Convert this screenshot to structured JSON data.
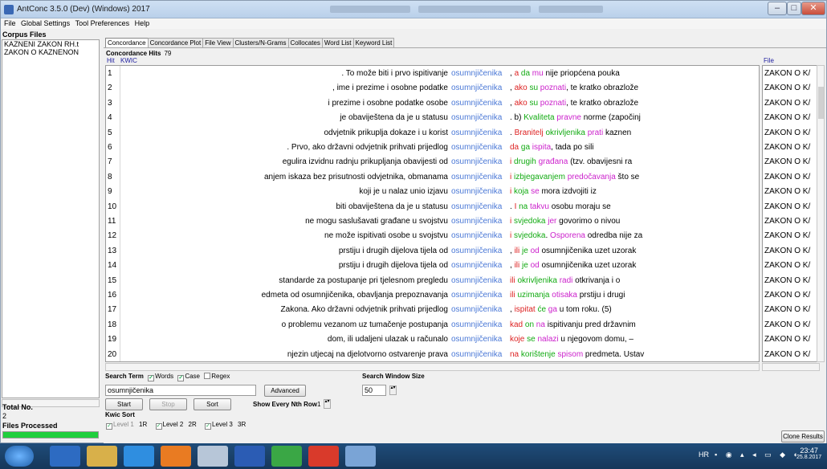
{
  "window": {
    "title": "AntConc 3.5.0 (Dev) (Windows) 2017"
  },
  "menu": [
    "File",
    "Global Settings",
    "Tool Preferences",
    "Help"
  ],
  "left": {
    "corpus_title": "Corpus Files",
    "files": [
      "KAZNENI ZAKON RH.t",
      "ZAKON O KAZNENON"
    ],
    "total_label": "Total No.",
    "total_value": "2",
    "processed_label": "Files Processed",
    "progress": 1.0
  },
  "tabs": [
    "Concordance",
    "Concordance Plot",
    "File View",
    "Clusters/N-Grams",
    "Collocates",
    "Word List",
    "Keyword List"
  ],
  "concordance": {
    "hits_label": "Concordance Hits",
    "hits_value": "79",
    "col_hit": "Hit",
    "col_kwic": "KWIC",
    "col_file": "File",
    "rows": [
      {
        "n": "1",
        "left": ". To može biti i prvo ispitivanje",
        "kw": "osumnjičenika",
        "right": [
          [
            ", ",
            "#000"
          ],
          [
            "a",
            "#d22"
          ],
          [
            " da",
            "#1a1"
          ],
          [
            " mu",
            "#c2c"
          ],
          [
            " nije priopćena pouka",
            "#000"
          ]
        ],
        "file": "ZAKON O K/"
      },
      {
        "n": "2",
        "left": ", ime i prezime i osobne podatke",
        "kw": "osumnjičenika",
        "right": [
          [
            ", ",
            "#000"
          ],
          [
            "ako",
            "#d22"
          ],
          [
            " su",
            "#1a1"
          ],
          [
            " poznati",
            "#c2c"
          ],
          [
            ", te kratko obrazlože",
            "#000"
          ]
        ],
        "file": "ZAKON O K/"
      },
      {
        "n": "3",
        "left": "i prezime i osobne podatke osobe",
        "kw": "osumnjičenika",
        "right": [
          [
            ", ",
            "#000"
          ],
          [
            "ako",
            "#d22"
          ],
          [
            " su",
            "#1a1"
          ],
          [
            " poznati",
            "#c2c"
          ],
          [
            ", te kratko obrazlože",
            "#000"
          ]
        ],
        "file": "ZAKON O K/"
      },
      {
        "n": "4",
        "left": "je obaviještena da je u statusu",
        "kw": "osumnjičenika",
        "right": [
          [
            ". b) ",
            "#000"
          ],
          [
            "Kvaliteta",
            "#1a1"
          ],
          [
            " pravne",
            "#c2c"
          ],
          [
            " norme (započinj",
            "#000"
          ]
        ],
        "file": "ZAKON O K/"
      },
      {
        "n": "5",
        "left": "odvjetnik prikuplja dokaze i u korist",
        "kw": "osumnjičenika",
        "right": [
          [
            ". ",
            "#000"
          ],
          [
            "Branitelj",
            "#d22"
          ],
          [
            " okrivljenika",
            "#1a1"
          ],
          [
            " prati",
            "#c2c"
          ],
          [
            " kaznen",
            "#000"
          ]
        ],
        "file": "ZAKON O K/"
      },
      {
        "n": "6",
        "left": ". Prvo, ako državni odvjetnik prihvati prijedlog",
        "kw": "osumnjičenika",
        "right": [
          [
            " ",
            "#000"
          ],
          [
            "da",
            "#d22"
          ],
          [
            " ga",
            "#1a1"
          ],
          [
            " ispita",
            "#c2c"
          ],
          [
            ", tada po sili",
            "#000"
          ]
        ],
        "file": "ZAKON O K/"
      },
      {
        "n": "7",
        "left": "egulira izvidnu radnju prikupljanja obavijesti od",
        "kw": "osumnjičenika",
        "right": [
          [
            " ",
            "#000"
          ],
          [
            "i",
            "#d22"
          ],
          [
            " drugih",
            "#1a1"
          ],
          [
            " građana",
            "#c2c"
          ],
          [
            " (tzv. obavijesni ra",
            "#000"
          ]
        ],
        "file": "ZAKON O K/"
      },
      {
        "n": "8",
        "left": "anjem iskaza bez prisutnosti odvjetnika, obmanama",
        "kw": "osumnjičenika",
        "right": [
          [
            " ",
            "#000"
          ],
          [
            "i",
            "#d22"
          ],
          [
            " izbjegavanjem",
            "#1a1"
          ],
          [
            " predočavanja",
            "#c2c"
          ],
          [
            " što se",
            "#000"
          ]
        ],
        "file": "ZAKON O K/"
      },
      {
        "n": "9",
        "left": "koji je u nalaz unio izjavu",
        "kw": "osumnjičenika",
        "right": [
          [
            " ",
            "#000"
          ],
          [
            "i",
            "#d22"
          ],
          [
            " koja",
            "#1a1"
          ],
          [
            " se",
            "#c2c"
          ],
          [
            " mora izdvojiti iz",
            "#000"
          ]
        ],
        "file": "ZAKON O K/"
      },
      {
        "n": "10",
        "left": "biti obaviještena da je u statusu",
        "kw": "osumnjičenika",
        "right": [
          [
            ". ",
            "#000"
          ],
          [
            "I",
            "#d22"
          ],
          [
            " na",
            "#1a1"
          ],
          [
            " takvu",
            "#c2c"
          ],
          [
            " osobu moraju se",
            "#000"
          ]
        ],
        "file": "ZAKON O K/"
      },
      {
        "n": "11",
        "left": "ne mogu saslušavati građane u svojstvu",
        "kw": "osumnjičenika",
        "right": [
          [
            " ",
            "#000"
          ],
          [
            "i",
            "#d22"
          ],
          [
            " svjedoka",
            "#1a1"
          ],
          [
            " jer",
            "#c2c"
          ],
          [
            " govorimo o nivou",
            "#000"
          ]
        ],
        "file": "ZAKON O K/"
      },
      {
        "n": "12",
        "left": "ne može ispitivati osobe u svojstvu",
        "kw": "osumnjičenika",
        "right": [
          [
            " ",
            "#000"
          ],
          [
            "i",
            "#d22"
          ],
          [
            " svjedoka",
            "#1a1"
          ],
          [
            ". ",
            "#000"
          ],
          [
            "Osporena",
            "#c2c"
          ],
          [
            " odredba nije za",
            "#000"
          ]
        ],
        "file": "ZAKON O K/"
      },
      {
        "n": "13",
        "left": "prstiju i drugih dijelova tijela od",
        "kw": "osumnjičenika",
        "right": [
          [
            ", ",
            "#000"
          ],
          [
            "ili",
            "#d22"
          ],
          [
            " je",
            "#1a1"
          ],
          [
            " od",
            "#c2c"
          ],
          [
            " osumnjičenika uzet uzorak",
            "#000"
          ]
        ],
        "file": "ZAKON O K/"
      },
      {
        "n": "14",
        "left": "prstiju i drugih dijelova tijela od",
        "kw": "osumnjičenika",
        "right": [
          [
            ", ",
            "#000"
          ],
          [
            "ili",
            "#d22"
          ],
          [
            " je",
            "#1a1"
          ],
          [
            " od",
            "#c2c"
          ],
          [
            " osumnjičenika uzet uzorak",
            "#000"
          ]
        ],
        "file": "ZAKON O K/"
      },
      {
        "n": "15",
        "left": "standarde za postupanje pri tjelesnom pregledu",
        "kw": "osumnjičenika",
        "right": [
          [
            " ",
            "#000"
          ],
          [
            "ili",
            "#d22"
          ],
          [
            " okrivljenika",
            "#1a1"
          ],
          [
            " radi",
            "#c2c"
          ],
          [
            " otkrivanja i o",
            "#000"
          ]
        ],
        "file": "ZAKON O K/"
      },
      {
        "n": "16",
        "left": "edmeta od osumnjičenika, obavljanja prepoznavanja",
        "kw": "osumnjičenika",
        "right": [
          [
            " ",
            "#000"
          ],
          [
            "ili",
            "#d22"
          ],
          [
            " uzimanja",
            "#1a1"
          ],
          [
            " otisaka",
            "#c2c"
          ],
          [
            " prstiju i drugi",
            "#000"
          ]
        ],
        "file": "ZAKON O K/"
      },
      {
        "n": "17",
        "left": "Zakona. Ako državni odvjetnik prihvati prijedlog",
        "kw": "osumnjičenika",
        "right": [
          [
            ", ",
            "#000"
          ],
          [
            "ispitat",
            "#d22"
          ],
          [
            " će",
            "#1a1"
          ],
          [
            " ga",
            "#c2c"
          ],
          [
            " u tom roku. (5)",
            "#000"
          ]
        ],
        "file": "ZAKON O K/"
      },
      {
        "n": "18",
        "left": "o problemu vezanom uz tumačenje postupanja",
        "kw": "osumnjičenika",
        "right": [
          [
            " ",
            "#000"
          ],
          [
            "kad",
            "#d22"
          ],
          [
            " on",
            "#1a1"
          ],
          [
            " na",
            "#c2c"
          ],
          [
            " ispitivanju pred državnim",
            "#000"
          ]
        ],
        "file": "ZAKON O K/"
      },
      {
        "n": "19",
        "left": "dom, ili udaljeni ulazak u računalo",
        "kw": "osumnjičenika",
        "right": [
          [
            " ",
            "#000"
          ],
          [
            "koje",
            "#d22"
          ],
          [
            " se",
            "#1a1"
          ],
          [
            " nalazi",
            "#c2c"
          ],
          [
            " u njegovom domu, –",
            "#000"
          ]
        ],
        "file": "ZAKON O K/"
      },
      {
        "n": "20",
        "left": "njezin utjecaj na djelotvorno ostvarenje prava",
        "kw": "osumnjičenika",
        "right": [
          [
            " ",
            "#000"
          ],
          [
            "na",
            "#d22"
          ],
          [
            " korištenje",
            "#1a1"
          ],
          [
            " spisom",
            "#c2c"
          ],
          [
            " predmeta. Ustav",
            "#000"
          ]
        ],
        "file": "ZAKON O K/"
      }
    ]
  },
  "search": {
    "label": "Search Term",
    "words": "Words",
    "case": "Case",
    "regex": "Regex",
    "value": "osumnjičenika",
    "advanced": "Advanced",
    "window_label": "Search Window Size",
    "window_value": "50",
    "start": "Start",
    "stop": "Stop",
    "sort": "Sort",
    "nth_label": "Show Every Nth Row",
    "nth_value": "1"
  },
  "kwic_sort": {
    "label": "Kwic Sort",
    "level1": "Level 1",
    "level1_val": "1R",
    "level2": "Level 2",
    "level2_val": "2R",
    "level3": "Level 3",
    "level3_val": "3R"
  },
  "clone_results": "Clone Results",
  "tray": {
    "lang": "HR",
    "time": "23:47",
    "date": "25.8.2017"
  }
}
